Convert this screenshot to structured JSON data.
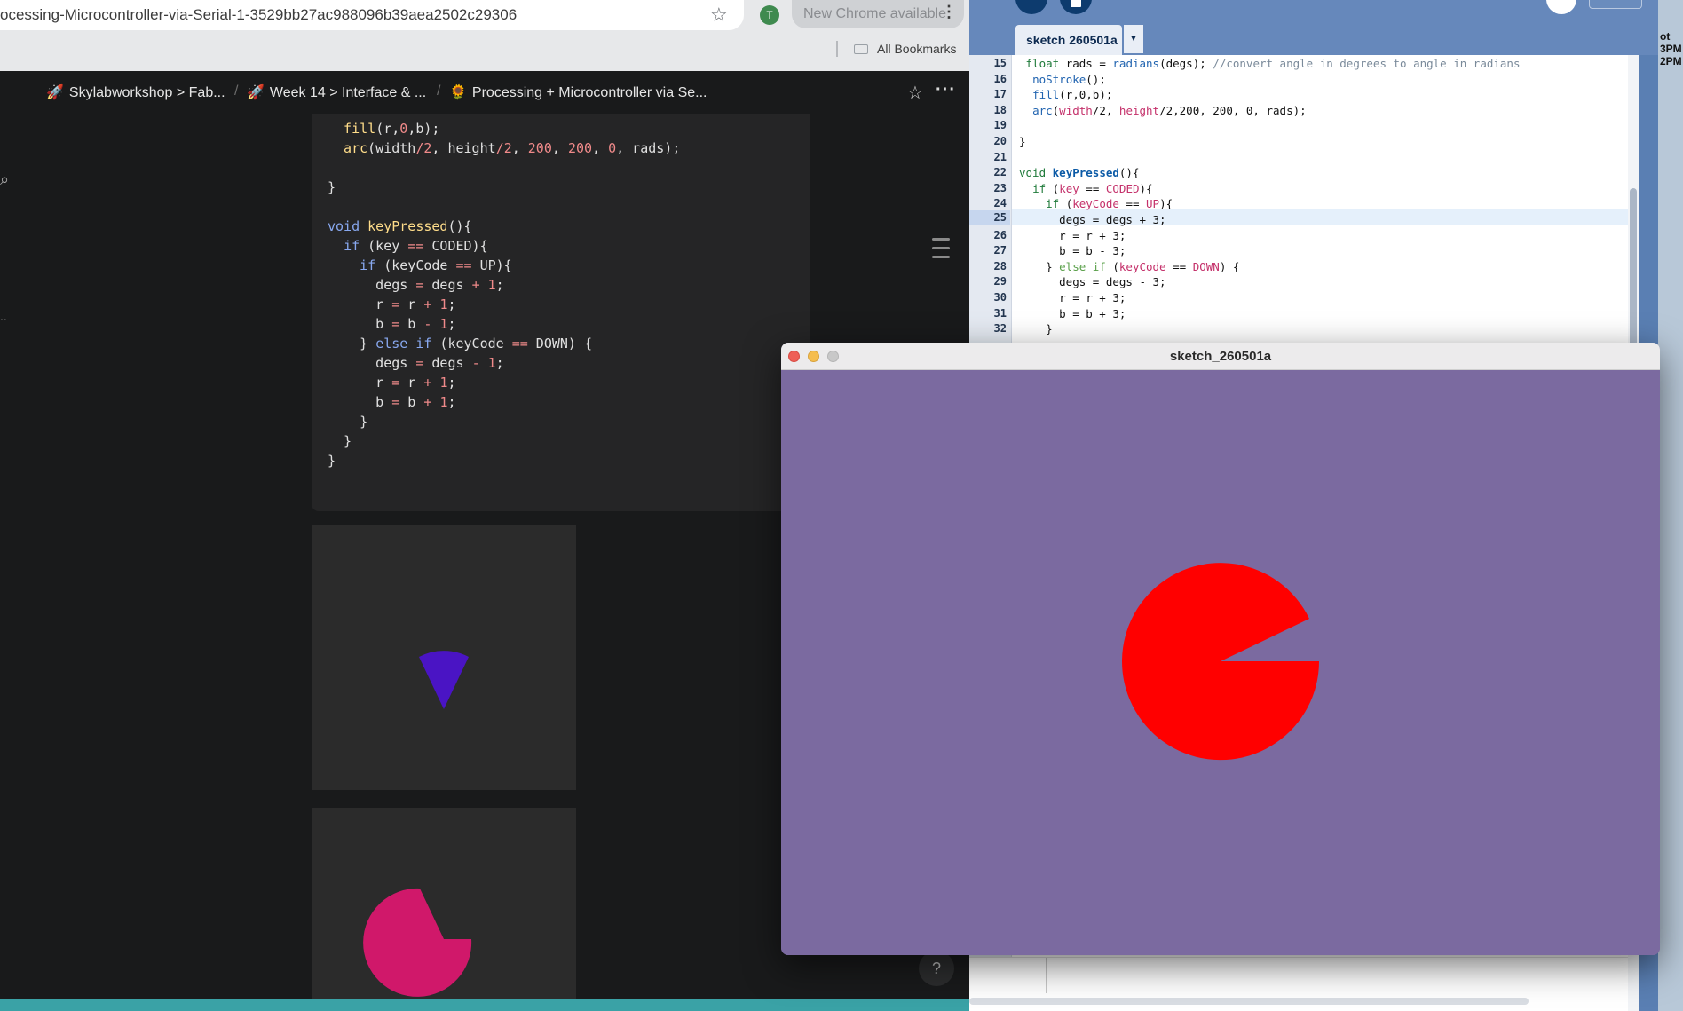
{
  "browser": {
    "url": "ocessing-Microcontroller-via-Serial-1-3529bb27ac988096b39aea2502c29306",
    "update_label": "New Chrome available",
    "profile_initial": "T",
    "bookmarks_label": "All Bookmarks"
  },
  "breadcrumbs": [
    {
      "icon": "🚀",
      "label": "Skylabworkshop > Fab..."
    },
    {
      "icon": "🚀",
      "label": "Week 14 > Interface & ..."
    },
    {
      "icon": "🌻",
      "label": "Processing + Microcontroller via Se..."
    }
  ],
  "doc_code_lines": [
    "  fill(r,0,b);",
    "  arc(width/2, height/2, 200, 200, 0, rads);",
    "",
    "}",
    "",
    "void keyPressed(){",
    "  if (key == CODED){",
    "    if (keyCode == UP){",
    "      degs = degs + 1;",
    "      r = r + 1;",
    "      b = b - 1;",
    "    } else if (keyCode == DOWN) {",
    "      degs = degs - 1;",
    "      r = r + 1;",
    "      b = b + 1;",
    "    }",
    "  }",
    "}"
  ],
  "previews": [
    {
      "color": "#4a14c4"
    },
    {
      "color": "#d0186a"
    }
  ],
  "help_label": "?",
  "ide": {
    "tab_label": "sketch 260501a",
    "active_line": "25",
    "line_numbers": [
      "15",
      "16",
      "17",
      "18",
      "19",
      "20",
      "21",
      "22",
      "23",
      "24",
      "25",
      "26",
      "27",
      "28",
      "29",
      "30",
      "31",
      "32"
    ],
    "code_lines": [
      " float rads = radians(degs); //convert angle in degrees to angle in radians",
      "  noStroke();",
      "  fill(r,0,b);",
      "  arc(width/2, height/2,200, 200, 0, rads);",
      "",
      "}",
      "",
      "void keyPressed(){",
      "  if (key == CODED){",
      "    if (keyCode == UP){",
      "      degs = degs + 3;",
      "      r = r + 3;",
      "      b = b - 3;",
      "    } else if (keyCode == DOWN) {",
      "      degs = degs - 3;",
      "      r = r + 3;",
      "      b = b + 3;",
      "    }"
    ]
  },
  "sketch_window": {
    "title": "sketch_260501a",
    "background": "#7b6aa0",
    "arc_color": "#ff0000"
  },
  "desktop_clock": {
    "line1": "ot",
    "line2": "3PM",
    "line3": "2PM"
  }
}
